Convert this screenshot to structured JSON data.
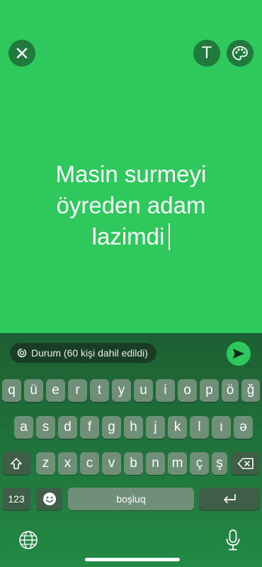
{
  "status": {
    "lines": [
      "Masin surmeyi",
      "öyreden adam",
      "lazimdi"
    ]
  },
  "toolbar": {
    "text_tool_label": "T"
  },
  "audience": {
    "label": "Durum (60 kişi dahil edildi)"
  },
  "keyboard": {
    "row1": [
      "q",
      "ü",
      "e",
      "r",
      "t",
      "y",
      "u",
      "i",
      "o",
      "p",
      "ö",
      "ğ"
    ],
    "row2": [
      "a",
      "s",
      "d",
      "f",
      "g",
      "h",
      "j",
      "k",
      "l",
      "ı",
      "ə"
    ],
    "row3": [
      "z",
      "x",
      "c",
      "v",
      "b",
      "n",
      "m",
      "ç",
      "ş"
    ],
    "numbers_key": "123",
    "space_key": "boşluq"
  },
  "icons": [
    "close-icon",
    "text-icon",
    "palette-icon",
    "ring-icon",
    "send-icon",
    "shift-icon",
    "backspace-icon",
    "emoji-icon",
    "return-icon",
    "globe-icon",
    "mic-icon"
  ],
  "colors": {
    "canvas": "#2fc85d",
    "button": "#1f7a3c",
    "key": "#6f8f78",
    "key_dark": "#3f5e47"
  }
}
